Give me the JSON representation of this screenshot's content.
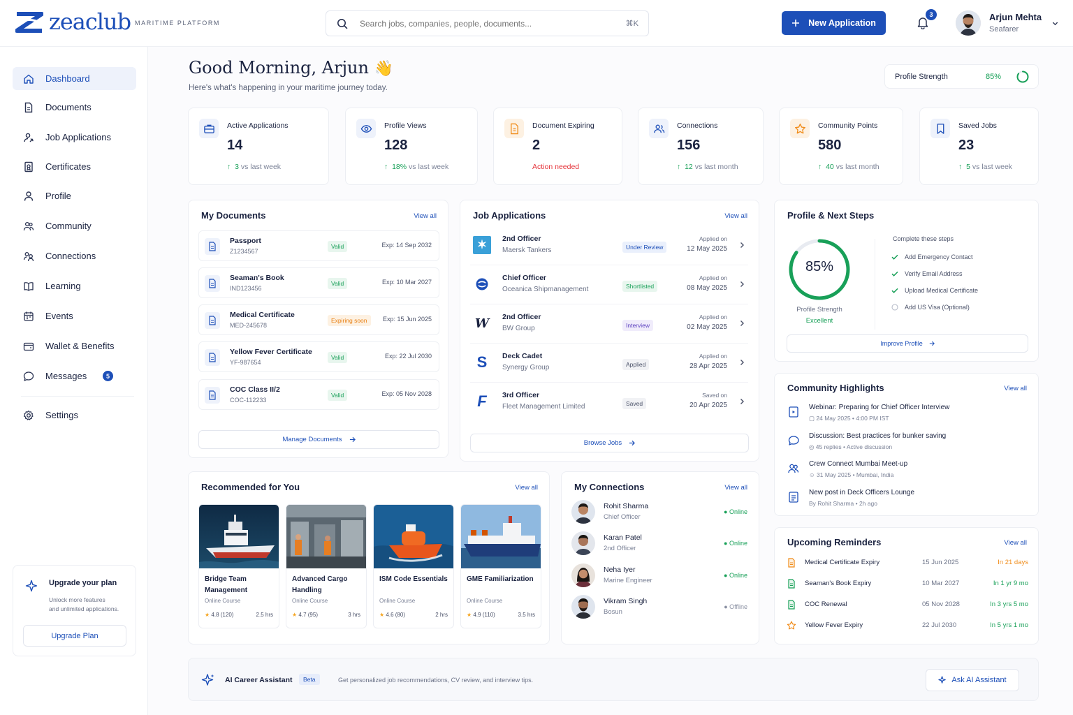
{
  "header": {
    "brand": "zeaclub",
    "tagline": "MARITIME PLATFORM",
    "search_placeholder": "Search jobs, companies, people, documents...",
    "search_shortcut": "⌘K",
    "new_application_label": "New Application",
    "notification_count": "3",
    "user_name": "Arjun Mehta",
    "user_role": "Seafarer"
  },
  "sidebar": {
    "items": [
      {
        "label": "Dashboard",
        "icon": "home-icon"
      },
      {
        "label": "Documents",
        "icon": "document-icon"
      },
      {
        "label": "Job Applications",
        "icon": "job-icon"
      },
      {
        "label": "Certificates",
        "icon": "certificate-icon"
      },
      {
        "label": "Profile",
        "icon": "user-icon"
      },
      {
        "label": "Community",
        "icon": "community-icon"
      },
      {
        "label": "Connections",
        "icon": "connections-icon"
      },
      {
        "label": "Learning",
        "icon": "book-icon"
      },
      {
        "label": "Events",
        "icon": "calendar-icon"
      },
      {
        "label": "Wallet & Benefits",
        "icon": "wallet-icon"
      },
      {
        "label": "Messages",
        "icon": "message-icon",
        "badge": "5"
      },
      {
        "label": "Settings",
        "icon": "gear-icon"
      }
    ],
    "upgrade": {
      "title": "Upgrade your plan",
      "line1": "Unlock more features",
      "line2": "and unlimited applications.",
      "button": "Upgrade Plan"
    }
  },
  "greeting": {
    "title": "Good Morning, Arjun",
    "emoji": "👋",
    "subtitle": "Here's what's happening in your maritime journey today."
  },
  "profile_strength": {
    "label": "Profile Strength",
    "value": "85%",
    "fraction": 0.85
  },
  "stats": [
    {
      "label": "Active Applications",
      "value": "14",
      "delta": "3",
      "delta_text": "vs last week",
      "icon": "briefcase-icon",
      "accent": "#1d4fb8"
    },
    {
      "label": "Profile Views",
      "value": "128",
      "delta": "18%",
      "delta_text": "vs last week",
      "icon": "eye-icon",
      "accent": "#1d4fb8"
    },
    {
      "label": "Document Expiring",
      "value": "2",
      "note": "Action needed",
      "icon": "file-warning-icon",
      "accent": "#f08c1a"
    },
    {
      "label": "Connections",
      "value": "156",
      "delta": "12",
      "delta_text": "vs last month",
      "icon": "users-icon",
      "accent": "#1d4fb8"
    },
    {
      "label": "Community Points",
      "value": "580",
      "delta": "40",
      "delta_text": "vs last month",
      "icon": "star-icon",
      "accent": "#f08c1a"
    },
    {
      "label": "Saved Jobs",
      "value": "23",
      "delta": "5",
      "delta_text": "vs last week",
      "icon": "bookmark-icon",
      "accent": "#1d4fb8"
    }
  ],
  "documents": {
    "title": "My Documents",
    "view_all": "View all",
    "items": [
      {
        "name": "Passport",
        "id": "Z1234567",
        "status": "Valid",
        "expiry": "Exp: 14 Sep 2032"
      },
      {
        "name": "Seaman's Book",
        "id": "IND123456",
        "status": "Valid",
        "expiry": "Exp: 10 Mar 2027"
      },
      {
        "name": "Medical Certificate",
        "id": "MED-245678",
        "status": "Expiring soon",
        "expiry": "Exp: 15 Jun 2025"
      },
      {
        "name": "Yellow Fever Certificate",
        "id": "YF-987654",
        "status": "Valid",
        "expiry": "Exp: 22 Jul 2030"
      },
      {
        "name": "COC Class II/2",
        "id": "COC-112233",
        "status": "Valid",
        "expiry": "Exp: 05 Nov 2028"
      }
    ],
    "manage": "Manage Documents"
  },
  "jobs": {
    "title": "Job Applications",
    "view_all": "View all",
    "items": [
      {
        "title": "2nd Officer",
        "company": "Maersk Tankers",
        "status": "Under Review",
        "date_label": "Applied on",
        "date": "12 May 2025"
      },
      {
        "title": "Chief Officer",
        "company": "Oceanica Shipmanagement",
        "status": "Shortlisted",
        "date_label": "Applied on",
        "date": "08 May 2025"
      },
      {
        "title": "2nd Officer",
        "company": "BW Group",
        "status": "Interview",
        "date_label": "Applied on",
        "date": "02 May 2025"
      },
      {
        "title": "Deck Cadet",
        "company": "Synergy Group",
        "status": "Applied",
        "date_label": "Applied on",
        "date": "28 Apr 2025"
      },
      {
        "title": "3rd Officer",
        "company": "Fleet Management Limited",
        "status": "Saved",
        "date_label": "Saved on",
        "date": "20 Apr 2025"
      }
    ],
    "browse": "Browse Jobs"
  },
  "next_steps": {
    "title": "Profile & Next Steps",
    "percent": "85%",
    "ring_label": "Profile Strength",
    "ring_status": "Excellent",
    "steps_title": "Complete these steps",
    "steps": [
      {
        "label": "Add Emergency Contact",
        "done": true
      },
      {
        "label": "Verify Email Address",
        "done": true
      },
      {
        "label": "Upload Medical Certificate",
        "done": true
      },
      {
        "label": "Add US Visa (Optional)",
        "done": false
      }
    ],
    "improve": "Improve Profile"
  },
  "community": {
    "title": "Community Highlights",
    "view_all": "View all",
    "items": [
      {
        "title": "Webinar: Preparing for Chief Officer Interview",
        "meta1": "24 May 2025",
        "meta2": "4:00 PM IST",
        "icon": "webinar-icon"
      },
      {
        "title": "Discussion: Best practices for bunker saving",
        "meta1": "45 replies",
        "meta2": "Active discussion",
        "icon": "chat-icon"
      },
      {
        "title": "Crew Connect Mumbai Meet-up",
        "meta1": "31 May 2025",
        "meta2": "Mumbai, India",
        "icon": "group-icon"
      },
      {
        "title": "New post in Deck Officers Lounge",
        "meta1": "By Rohit Sharma",
        "meta2": "2h ago",
        "icon": "post-icon"
      }
    ]
  },
  "reminders": {
    "title": "Upcoming Reminders",
    "view_all": "View all",
    "items": [
      {
        "name": "Medical Certificate Expiry",
        "date": "15 Jun 2025",
        "when": "In 21 days",
        "color": "#f08c1a"
      },
      {
        "name": "Seaman's Book Expiry",
        "date": "10 Mar 2027",
        "when": "In 1 yr 9 mo",
        "color": "#18a058"
      },
      {
        "name": "COC Renewal",
        "date": "05 Nov 2028",
        "when": "In 3 yrs 5 mo",
        "color": "#18a058"
      },
      {
        "name": "Yellow Fever Expiry",
        "date": "22 Jul 2030",
        "when": "In 5 yrs 1 mo",
        "color": "#18a058"
      }
    ]
  },
  "recommended": {
    "title": "Recommended for You",
    "view_all": "View all",
    "items": [
      {
        "title": "Bridge Team Management",
        "type": "Online Course",
        "rating": "4.8",
        "reviews": "(120)",
        "hours": "2.5 hrs"
      },
      {
        "title": "Advanced Cargo Handling",
        "type": "Online Course",
        "rating": "4.7",
        "reviews": "(95)",
        "hours": "3 hrs"
      },
      {
        "title": "ISM Code Essentials",
        "type": "Online Course",
        "rating": "4.6",
        "reviews": "(80)",
        "hours": "2 hrs"
      },
      {
        "title": "GME Familiarization",
        "type": "Online Course",
        "rating": "4.9",
        "reviews": "(110)",
        "hours": "3.5 hrs"
      }
    ]
  },
  "connections": {
    "title": "My Connections",
    "view_all": "View all",
    "items": [
      {
        "name": "Rohit Sharma",
        "role": "Chief Officer",
        "status": "Online"
      },
      {
        "name": "Karan Patel",
        "role": "2nd Officer",
        "status": "Online"
      },
      {
        "name": "Neha Iyer",
        "role": "Marine Engineer",
        "status": "Online"
      },
      {
        "name": "Vikram Singh",
        "role": "Bosun",
        "status": "Offline"
      }
    ]
  },
  "assistant": {
    "title": "AI Career Assistant",
    "badge": "Beta",
    "description": "Get personalized job recommendations, CV review, and interview tips.",
    "button": "Ask AI Assistant"
  }
}
